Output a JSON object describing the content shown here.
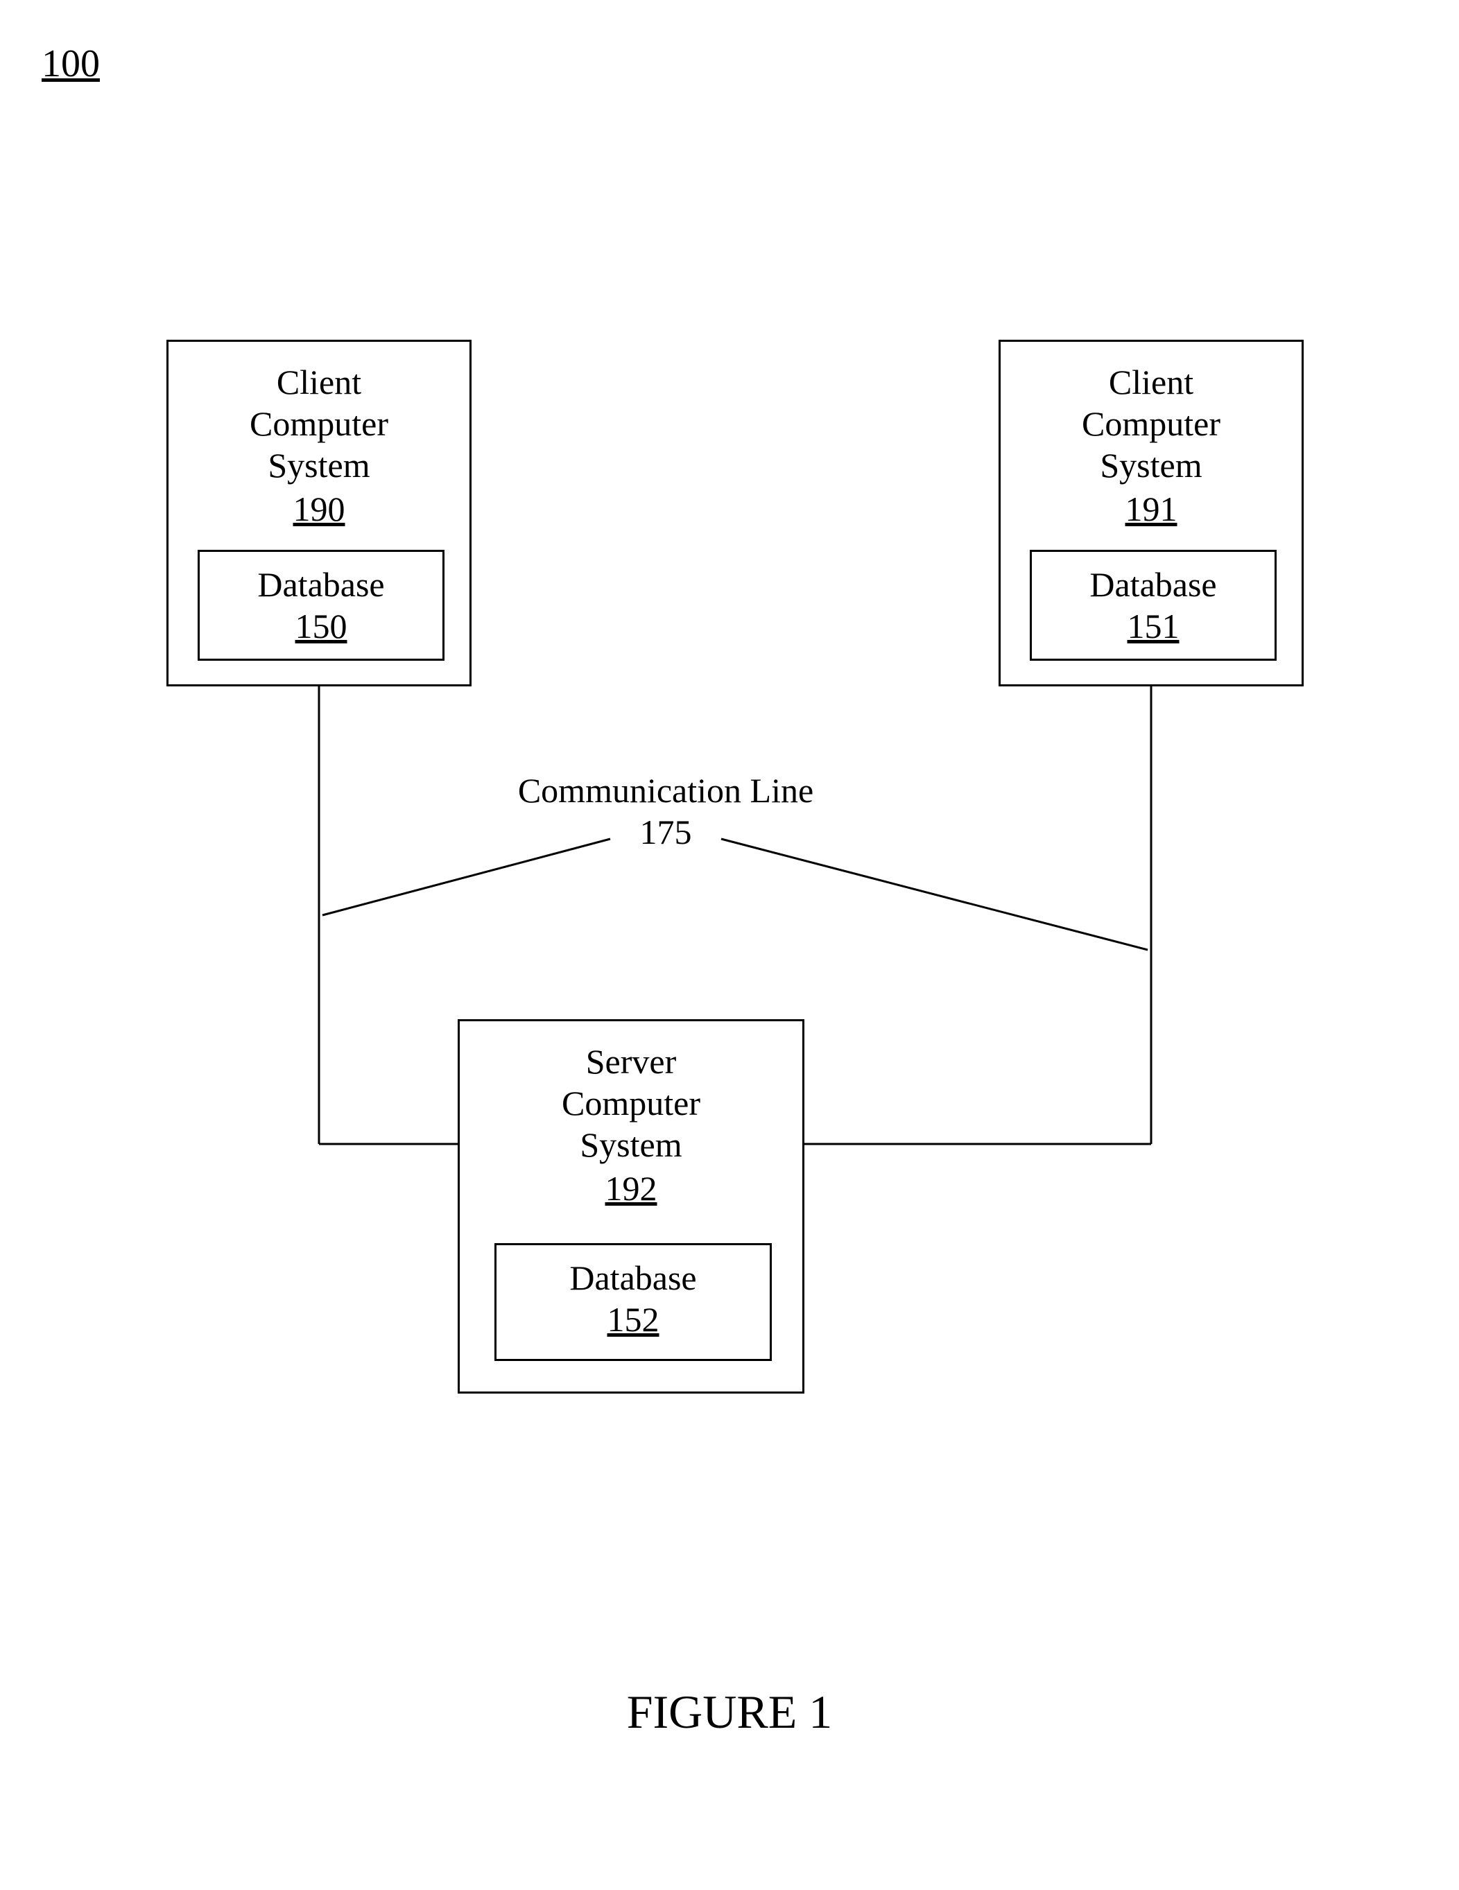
{
  "figureNumber": "100",
  "caption": "FIGURE 1",
  "commLine": {
    "label": "Communication Line",
    "ref": "175"
  },
  "nodes": {
    "clientLeft": {
      "line1": "Client",
      "line2": "Computer",
      "line3": "System",
      "ref": "190",
      "dbLabel": "Database",
      "dbRef": "150"
    },
    "clientRight": {
      "line1": "Client",
      "line2": "Computer",
      "line3": "System",
      "ref": "191",
      "dbLabel": "Database",
      "dbRef": "151"
    },
    "server": {
      "line1": "Server",
      "line2": "Computer",
      "line3": "System",
      "ref": "192",
      "dbLabel": "Database",
      "dbRef": "152"
    }
  }
}
